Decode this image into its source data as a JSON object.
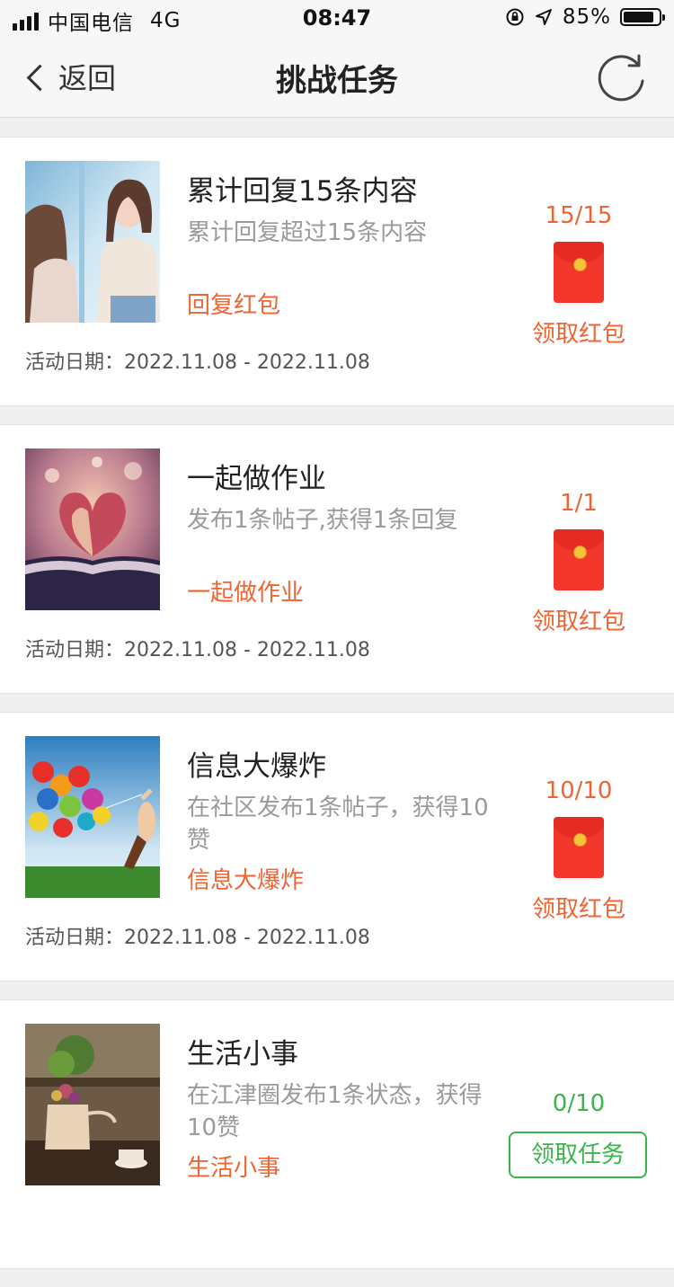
{
  "status_bar": {
    "carrier": "中国电信",
    "network": "4G",
    "time": "08:47",
    "battery": "85%"
  },
  "nav": {
    "back_label": "返回",
    "title": "挑战任务"
  },
  "tasks": [
    {
      "title": "累计回复15条内容",
      "description": "累计回复超过15条内容",
      "tag": "回复红包",
      "date": "活动日期：2022.11.08 - 2022.11.08",
      "progress": "15/15",
      "action": "领取红包"
    },
    {
      "title": "一起做作业",
      "description": "发布1条帖子,获得1条回复",
      "tag": "一起做作业",
      "date": "活动日期：2022.11.08 - 2022.11.08",
      "progress": "1/1",
      "action": "领取红包"
    },
    {
      "title": "信息大爆炸",
      "description": "在社区发布1条帖子，获得10赞",
      "tag": "信息大爆炸",
      "date": "活动日期：2022.11.08 - 2022.11.08",
      "progress": "10/10",
      "action": "领取红包"
    },
    {
      "title": "生活小事",
      "description": "在江津圈发布1条状态，获得10赞",
      "tag": "生活小事",
      "progress": "0/10",
      "action": "领取任务"
    }
  ],
  "colors": {
    "accent_orange": "#ee6533",
    "accent_green": "#39b54a",
    "envelope_red": "#f2362b"
  },
  "icons": [
    "signal-icon",
    "orientation-lock-icon",
    "location-arrow-icon",
    "battery-icon",
    "back-chevron-icon",
    "refresh-icon",
    "red-envelope-icon"
  ]
}
